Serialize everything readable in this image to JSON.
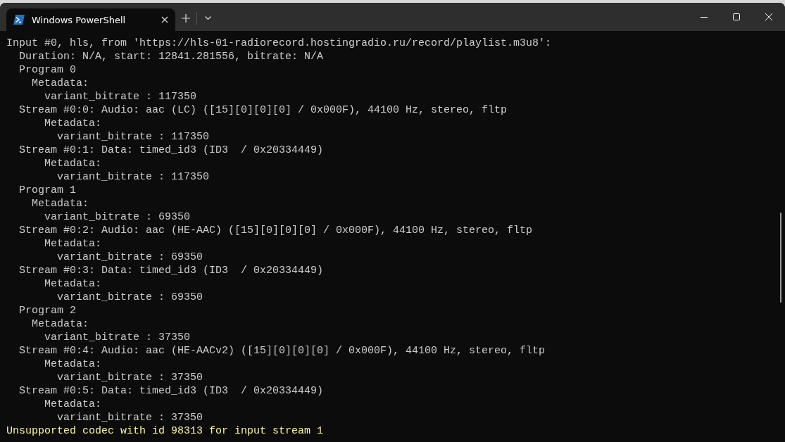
{
  "tabs": [
    {
      "title": "Windows PowerShell",
      "selected": true
    }
  ],
  "terminal": {
    "lines": [
      {
        "kind": "output",
        "text": "Input #0, hls, from 'https://hls-01-radiorecord.hostingradio.ru/record/playlist.m3u8':"
      },
      {
        "kind": "output",
        "text": "  Duration: N/A, start: 12841.281556, bitrate: N/A"
      },
      {
        "kind": "output",
        "text": "  Program 0"
      },
      {
        "kind": "output",
        "text": "    Metadata:"
      },
      {
        "kind": "output",
        "text": "      variant_bitrate : 117350"
      },
      {
        "kind": "output",
        "text": "  Stream #0:0: Audio: aac (LC) ([15][0][0][0] / 0x000F), 44100 Hz, stereo, fltp"
      },
      {
        "kind": "output",
        "text": "      Metadata:"
      },
      {
        "kind": "output",
        "text": "        variant_bitrate : 117350"
      },
      {
        "kind": "output",
        "text": "  Stream #0:1: Data: timed_id3 (ID3  / 0x20334449)"
      },
      {
        "kind": "output",
        "text": "      Metadata:"
      },
      {
        "kind": "output",
        "text": "        variant_bitrate : 117350"
      },
      {
        "kind": "output",
        "text": "  Program 1"
      },
      {
        "kind": "output",
        "text": "    Metadata:"
      },
      {
        "kind": "output",
        "text": "      variant_bitrate : 69350"
      },
      {
        "kind": "output",
        "text": "  Stream #0:2: Audio: aac (HE-AAC) ([15][0][0][0] / 0x000F), 44100 Hz, stereo, fltp"
      },
      {
        "kind": "output",
        "text": "      Metadata:"
      },
      {
        "kind": "output",
        "text": "        variant_bitrate : 69350"
      },
      {
        "kind": "output",
        "text": "  Stream #0:3: Data: timed_id3 (ID3  / 0x20334449)"
      },
      {
        "kind": "output",
        "text": "      Metadata:"
      },
      {
        "kind": "output",
        "text": "        variant_bitrate : 69350"
      },
      {
        "kind": "output",
        "text": "  Program 2"
      },
      {
        "kind": "output",
        "text": "    Metadata:"
      },
      {
        "kind": "output",
        "text": "      variant_bitrate : 37350"
      },
      {
        "kind": "output",
        "text": "  Stream #0:4: Audio: aac (HE-AACv2) ([15][0][0][0] / 0x000F), 44100 Hz, stereo, fltp"
      },
      {
        "kind": "output",
        "text": "      Metadata:"
      },
      {
        "kind": "output",
        "text": "        variant_bitrate : 37350"
      },
      {
        "kind": "output",
        "text": "  Stream #0:5: Data: timed_id3 (ID3  / 0x20334449)"
      },
      {
        "kind": "output",
        "text": "      Metadata:"
      },
      {
        "kind": "output",
        "text": "        variant_bitrate : 37350"
      },
      {
        "kind": "warning",
        "text": "Unsupported codec with id 98313 for input stream 1"
      }
    ]
  }
}
